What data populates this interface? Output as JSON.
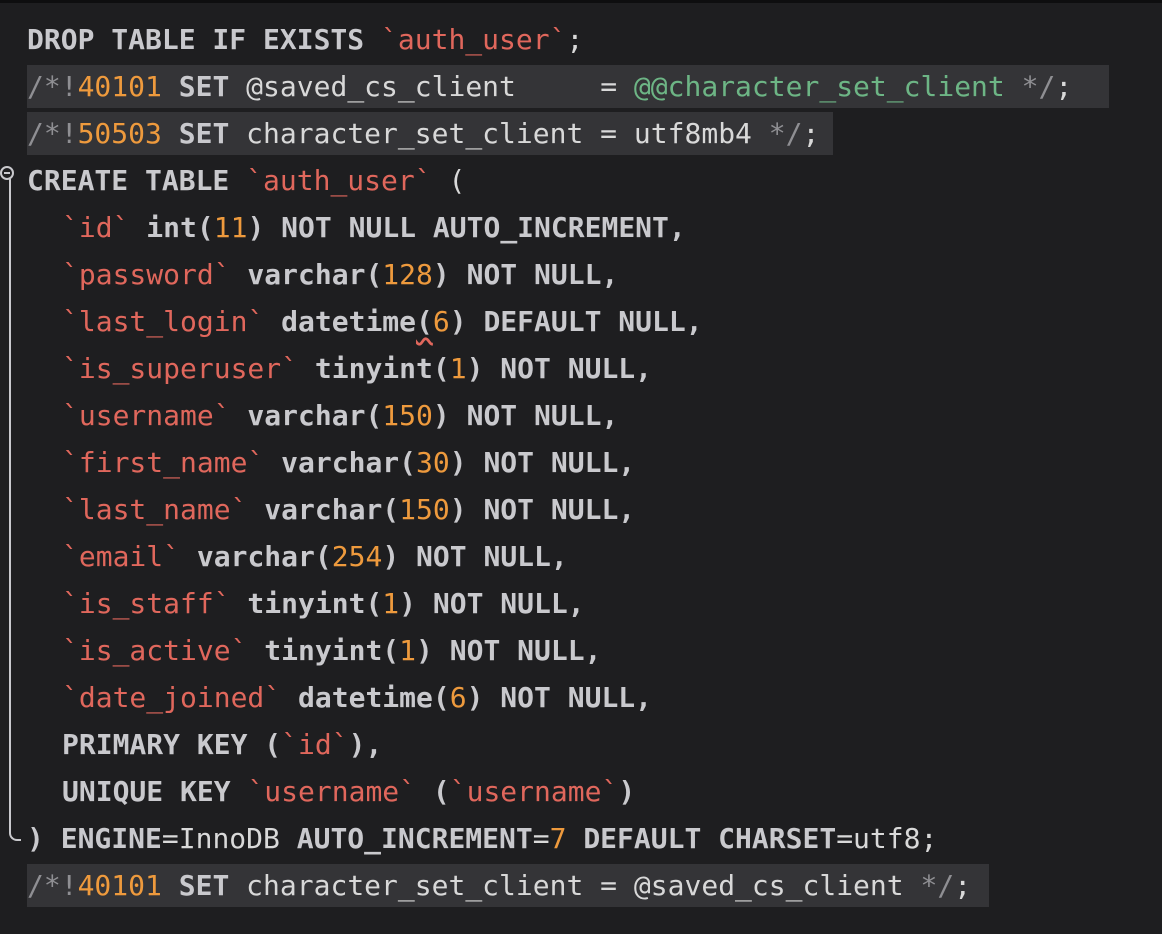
{
  "editor": {
    "language": "SQL",
    "lines": [
      {
        "id": 1,
        "text": "DROP TABLE IF EXISTS `auth_user`;"
      },
      {
        "id": 2,
        "text": "/*!40101 SET @saved_cs_client     = @@character_set_client */;"
      },
      {
        "id": 3,
        "text": "/*!50503 SET character_set_client = utf8mb4 */;"
      },
      {
        "id": 4,
        "text": "CREATE TABLE `auth_user` ("
      },
      {
        "id": 5,
        "text": "  `id` int(11) NOT NULL AUTO_INCREMENT,"
      },
      {
        "id": 6,
        "text": "  `password` varchar(128) NOT NULL,"
      },
      {
        "id": 7,
        "text": "  `last_login` datetime(6) DEFAULT NULL,"
      },
      {
        "id": 8,
        "text": "  `is_superuser` tinyint(1) NOT NULL,"
      },
      {
        "id": 9,
        "text": "  `username` varchar(150) NOT NULL,"
      },
      {
        "id": 10,
        "text": "  `first_name` varchar(30) NOT NULL,"
      },
      {
        "id": 11,
        "text": "  `last_name` varchar(150) NOT NULL,"
      },
      {
        "id": 12,
        "text": "  `email` varchar(254) NOT NULL,"
      },
      {
        "id": 13,
        "text": "  `is_staff` tinyint(1) NOT NULL,"
      },
      {
        "id": 14,
        "text": "  `is_active` tinyint(1) NOT NULL,"
      },
      {
        "id": 15,
        "text": "  `date_joined` datetime(6) NOT NULL,"
      },
      {
        "id": 16,
        "text": "  PRIMARY KEY (`id`),"
      },
      {
        "id": 17,
        "text": "  UNIQUE KEY `username` (`username`)"
      },
      {
        "id": 18,
        "text": ") ENGINE=InnoDB AUTO_INCREMENT=7 DEFAULT CHARSET=utf8;"
      },
      {
        "id": 19,
        "text": "/*!40101 SET character_set_client = @saved_cs_client */;"
      }
    ],
    "tokens": {
      "l1": {
        "kw": "DROP TABLE IF EXISTS ",
        "str": "`auth_user`",
        "end": ";"
      },
      "l2": {
        "c1": "/*!",
        "n": "40101",
        "kw": " SET ",
        "v": "@saved_cs_client",
        "sp": "     ",
        "eq": "= ",
        "sv": "@@character_set_client",
        "c2": " */",
        "end": ";"
      },
      "l3": {
        "c1": "/*!",
        "n": "50503",
        "kw": " SET ",
        "v": "character_set_client",
        "eq": " = ",
        "p": "utf8mb4",
        "c2": " */",
        "end": ";"
      },
      "l4": {
        "kw": "CREATE TABLE ",
        "str": "`auth_user`",
        "end": " ("
      },
      "l5": {
        "str": "`id`",
        "kw1": " int(",
        "n": "11",
        "kw2": ") NOT NULL AUTO_INCREMENT,"
      },
      "l6": {
        "str": "`password`",
        "kw1": " varchar(",
        "n": "128",
        "kw2": ") NOT NULL,"
      },
      "l7": {
        "str": "`last_login`",
        "kw1": " datetime",
        "sq": "(",
        "n": "6",
        "kw2": ") DEFAULT NULL,"
      },
      "l8": {
        "str": "`is_superuser`",
        "kw1": " tinyint(",
        "n": "1",
        "kw2": ") NOT NULL,"
      },
      "l9": {
        "str": "`username`",
        "kw1": " varchar(",
        "n": "150",
        "kw2": ") NOT NULL,"
      },
      "l10": {
        "str": "`first_name`",
        "kw1": " varchar(",
        "n": "30",
        "kw2": ") NOT NULL,"
      },
      "l11": {
        "str": "`last_name`",
        "kw1": " varchar(",
        "n": "150",
        "kw2": ") NOT NULL,"
      },
      "l12": {
        "str": "`email`",
        "kw1": " varchar(",
        "n": "254",
        "kw2": ") NOT NULL,"
      },
      "l13": {
        "str": "`is_staff`",
        "kw1": " tinyint(",
        "n": "1",
        "kw2": ") NOT NULL,"
      },
      "l14": {
        "str": "`is_active`",
        "kw1": " tinyint(",
        "n": "1",
        "kw2": ") NOT NULL,"
      },
      "l15": {
        "str": "`date_joined`",
        "kw1": " datetime(",
        "n": "6",
        "kw2": ") NOT NULL,"
      },
      "l16": {
        "kw": "PRIMARY KEY (",
        "str": "`id`",
        "end": "),"
      },
      "l17": {
        "kw": "UNIQUE KEY ",
        "str1": "`username`",
        "mid": " (",
        "str2": "`username`",
        "end": ")"
      },
      "l18": {
        "p1": ") ",
        "kw1": "ENGINE",
        "p2": "=InnoDB ",
        "kw2": "AUTO_INCREMENT",
        "p3": "=",
        "n": "7",
        "kw3": " DEFAULT CHARSET",
        "p4": "=utf8;"
      },
      "l19": {
        "c1": "/*!",
        "n": "40101",
        "kw": " SET ",
        "v": "character_set_client",
        "eq": " = ",
        "v2": "@saved_cs_client",
        "c2": " */",
        "end": ";"
      }
    },
    "colors": {
      "background": "#1e1e20",
      "keyword": "#c9c9cd",
      "string": "#e0675c",
      "number": "#ee9a3d",
      "comment": "#8f8f93",
      "system_variable": "#6db585",
      "highlight": "#343437"
    }
  }
}
